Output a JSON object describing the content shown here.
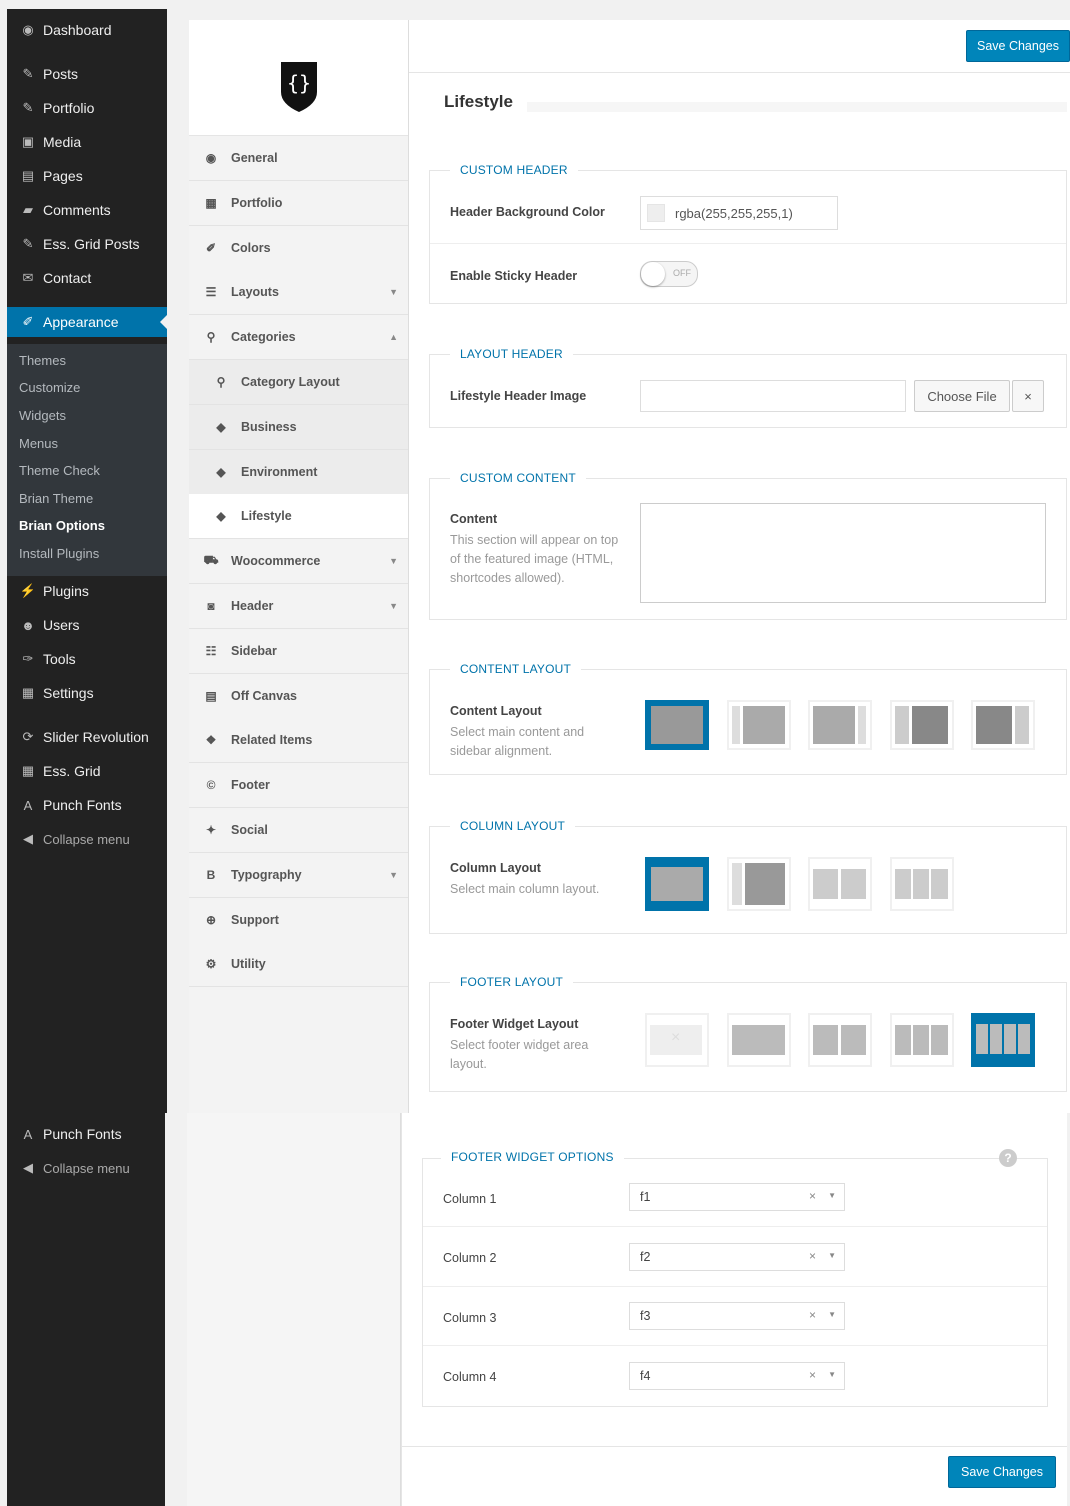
{
  "wp_menu": {
    "items": [
      {
        "label": "Dashboard",
        "icon": "dashboard-icon"
      },
      {
        "label": "Posts",
        "icon": "pin-icon"
      },
      {
        "label": "Portfolio",
        "icon": "pin-icon"
      },
      {
        "label": "Media",
        "icon": "media-icon"
      },
      {
        "label": "Pages",
        "icon": "page-icon"
      },
      {
        "label": "Comments",
        "icon": "comment-icon"
      },
      {
        "label": "Ess. Grid Posts",
        "icon": "pin-icon"
      },
      {
        "label": "Contact",
        "icon": "mail-icon"
      },
      {
        "label": "Appearance",
        "icon": "brush-icon"
      },
      {
        "label": "Plugins",
        "icon": "plugin-icon"
      },
      {
        "label": "Users",
        "icon": "users-icon"
      },
      {
        "label": "Tools",
        "icon": "wrench-icon"
      },
      {
        "label": "Settings",
        "icon": "settings-icon"
      },
      {
        "label": "Slider Revolution",
        "icon": "refresh-icon"
      },
      {
        "label": "Ess. Grid",
        "icon": "grid-icon"
      },
      {
        "label": "Punch Fonts",
        "icon": "font-icon"
      },
      {
        "label": "Collapse menu",
        "icon": "collapse-icon"
      }
    ],
    "appearance_sub": [
      "Themes",
      "Customize",
      "Widgets",
      "Menus",
      "Theme Check",
      "Brian Theme",
      "Brian Options",
      "Install Plugins"
    ],
    "repeat": [
      {
        "label": "Punch Fonts"
      },
      {
        "label": "Collapse menu"
      }
    ]
  },
  "options_nav": [
    {
      "label": "General",
      "icon": "dashboard-icon"
    },
    {
      "label": "Portfolio",
      "icon": "grid-icon"
    },
    {
      "label": "Colors",
      "icon": "brush-icon"
    },
    {
      "label": "Layouts",
      "icon": "layout-icon",
      "arrow": "▼"
    },
    {
      "label": "Categories",
      "icon": "sitemap-icon",
      "arrow": "▲"
    },
    {
      "label": "Category Layout",
      "icon": "sitemap-icon",
      "sub": true
    },
    {
      "label": "Business",
      "icon": "tag-icon",
      "sub": true
    },
    {
      "label": "Environment",
      "icon": "tag-icon",
      "sub": true
    },
    {
      "label": "Lifestyle",
      "icon": "tag-icon",
      "sub": true,
      "current": true
    },
    {
      "label": "Woocommerce",
      "icon": "cart-icon",
      "arrow": "▼"
    },
    {
      "label": "Header",
      "icon": "camera-icon",
      "arrow": "▼"
    },
    {
      "label": "Sidebar",
      "icon": "list-icon"
    },
    {
      "label": "Off Canvas",
      "icon": "canvas-icon"
    },
    {
      "label": "Related Items",
      "icon": "cubes-icon"
    },
    {
      "label": "Footer",
      "icon": "copyright-icon"
    },
    {
      "label": "Social",
      "icon": "twitter-icon"
    },
    {
      "label": "Typography",
      "icon": "bold-icon",
      "arrow": "▼"
    },
    {
      "label": "Support",
      "icon": "support-icon"
    },
    {
      "label": "Utility",
      "icon": "utility-icon"
    }
  ],
  "toolbar": {
    "save_label": "Save Changes"
  },
  "page": {
    "title": "Lifestyle"
  },
  "custom_header": {
    "heading": "CUSTOM HEADER",
    "bg_color_label": "Header Background Color",
    "bg_color_value": "rgba(255,255,255,1)",
    "sticky_label": "Enable Sticky Header",
    "sticky_state": "OFF"
  },
  "layout_header": {
    "heading": "LAYOUT HEADER",
    "image_label": "Lifestyle Header Image",
    "choose_file": "Choose File",
    "remove": "×"
  },
  "custom_content": {
    "heading": "CUSTOM CONTENT",
    "label": "Content",
    "desc": "This section will appear on top of the featured image (HTML, shortcodes allowed)."
  },
  "content_layout": {
    "heading": "CONTENT LAYOUT",
    "label": "Content Layout",
    "desc": "Select main content and sidebar alignment.",
    "selected": 0
  },
  "column_layout": {
    "heading": "COLUMN LAYOUT",
    "label": "Column Layout",
    "desc": "Select main column layout.",
    "selected": 0
  },
  "footer_layout": {
    "heading": "FOOTER LAYOUT",
    "label": "Footer Widget Layout",
    "desc": "Select footer widget area layout.",
    "selected": 4,
    "none_glyph": "×"
  },
  "footer_widget_options": {
    "heading": "FOOTER WIDGET OPTIONS",
    "help": "?",
    "columns": [
      {
        "label": "Column 1",
        "value": "f1"
      },
      {
        "label": "Column 2",
        "value": "f2"
      },
      {
        "label": "Column 3",
        "value": "f3"
      },
      {
        "label": "Column 4",
        "value": "f4"
      }
    ],
    "clear": "×",
    "dropdown": "▼"
  },
  "colors": {
    "accent": "#0073aa",
    "wp_dark": "#222222",
    "button": "#0085ba"
  }
}
